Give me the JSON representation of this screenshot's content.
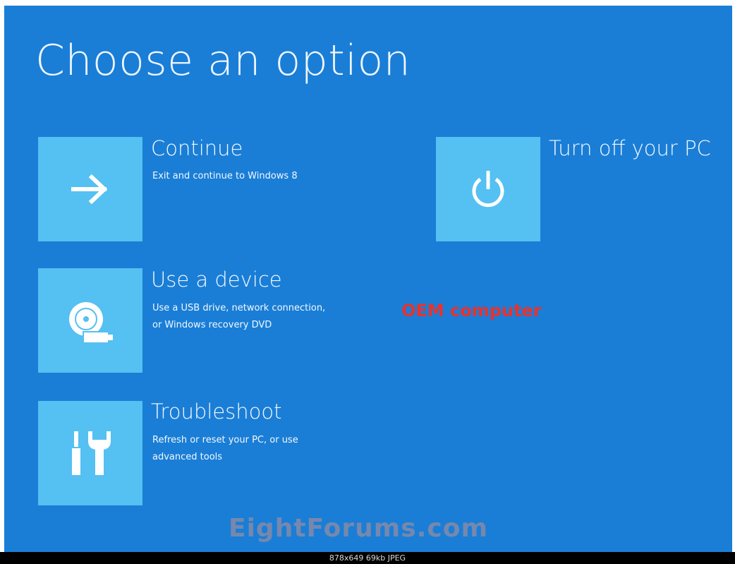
{
  "screen": {
    "title": "Choose an option",
    "background_color": "#1a7ed6",
    "tile_color": "#55c0f2"
  },
  "options": [
    {
      "title": "Continue",
      "description": [
        "Exit and continue to Windows 8"
      ],
      "icon": "arrow-right-icon"
    },
    {
      "title": "Use a device",
      "description": [
        "Use a USB drive, network connection,",
        "or Windows recovery DVD"
      ],
      "icon": "disc-usb-icon"
    },
    {
      "title": "Troubleshoot",
      "description": [
        "Refresh or reset your PC, or use",
        "advanced tools"
      ],
      "icon": "tools-icon"
    },
    {
      "title": "Turn off your PC",
      "description": [],
      "icon": "power-icon"
    }
  ],
  "annotation": {
    "text": "OEM computer",
    "color": "#e8322e"
  },
  "watermark": "EightForums.com",
  "image_info": "878x649 69kb JPEG"
}
